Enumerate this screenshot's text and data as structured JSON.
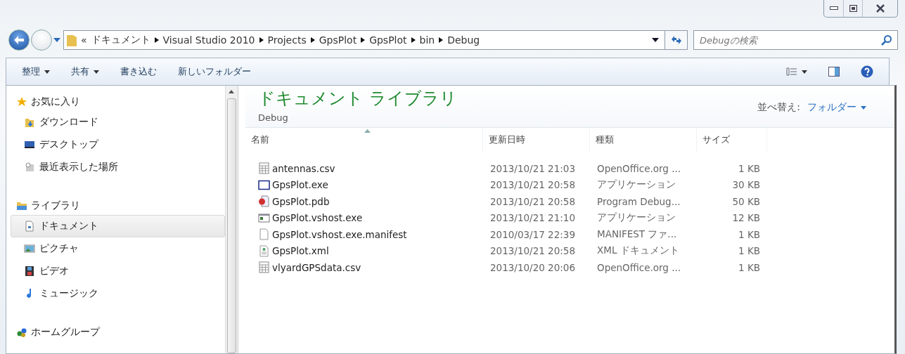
{
  "address_bar": {
    "overflow": "«",
    "path": [
      "ドキュメント",
      "Visual Studio 2010",
      "Projects",
      "GpsPlot",
      "GpsPlot",
      "bin",
      "Debug"
    ]
  },
  "search": {
    "placeholder": "Debugの検索"
  },
  "toolbar": [
    {
      "label": "整理",
      "has_menu": true
    },
    {
      "label": "共有",
      "has_menu": true
    },
    {
      "label": "書き込む",
      "has_menu": false
    },
    {
      "label": "新しいフォルダー",
      "has_menu": false
    }
  ],
  "sidebar": {
    "groups": [
      {
        "label": "お気に入り",
        "kind": "star",
        "children": [
          {
            "label": "ダウンロード",
            "kind": "download",
            "selected": false
          },
          {
            "label": "デスクトップ",
            "kind": "desktop",
            "selected": false
          },
          {
            "label": "最近表示した場所",
            "kind": "recent",
            "selected": false
          }
        ]
      },
      {
        "label": "ライブラリ",
        "kind": "library",
        "children": [
          {
            "label": "ドキュメント",
            "kind": "document",
            "selected": true
          },
          {
            "label": "ピクチャ",
            "kind": "picture",
            "selected": false
          },
          {
            "label": "ビデオ",
            "kind": "video",
            "selected": false
          },
          {
            "label": "ミュージック",
            "kind": "music",
            "selected": false
          }
        ]
      },
      {
        "label": "ホームグループ",
        "kind": "homegroup"
      }
    ]
  },
  "library": {
    "title": "ドキュメント ライブラリ",
    "subtitle": "Debug",
    "arrange_label": "並べ替え:",
    "arrange_value": "フォルダー"
  },
  "table": {
    "columns": [
      {
        "label": "名前",
        "sorted": true
      },
      {
        "label": "更新日時",
        "sorted": false
      },
      {
        "label": "種類",
        "sorted": false
      },
      {
        "label": "サイズ",
        "sorted": false
      }
    ],
    "rows": [
      {
        "kind": "csv",
        "name": "antennas.csv",
        "date": "2013/10/21 21:03",
        "type": "OpenOffice.org ...",
        "size": "1 KB"
      },
      {
        "kind": "exe",
        "name": "GpsPlot.exe",
        "date": "2013/10/21 20:58",
        "type": "アプリケーション",
        "size": "30 KB"
      },
      {
        "kind": "pdb",
        "name": "GpsPlot.pdb",
        "date": "2013/10/21 20:58",
        "type": "Program Debug...",
        "size": "50 KB"
      },
      {
        "kind": "vshost",
        "name": "GpsPlot.vshost.exe",
        "date": "2013/10/21 21:10",
        "type": "アプリケーション",
        "size": "12 KB"
      },
      {
        "kind": "blank",
        "name": "GpsPlot.vshost.exe.manifest",
        "date": "2010/03/17 22:39",
        "type": "MANIFEST ファ...",
        "size": "1 KB"
      },
      {
        "kind": "xml",
        "name": "GpsPlot.xml",
        "date": "2013/10/21 20:58",
        "type": "XML ドキュメント",
        "size": "1 KB"
      },
      {
        "kind": "csv",
        "name": "vlyardGPSdata.csv",
        "date": "2013/10/20 20:06",
        "type": "OpenOffice.org ...",
        "size": "1 KB"
      }
    ]
  }
}
